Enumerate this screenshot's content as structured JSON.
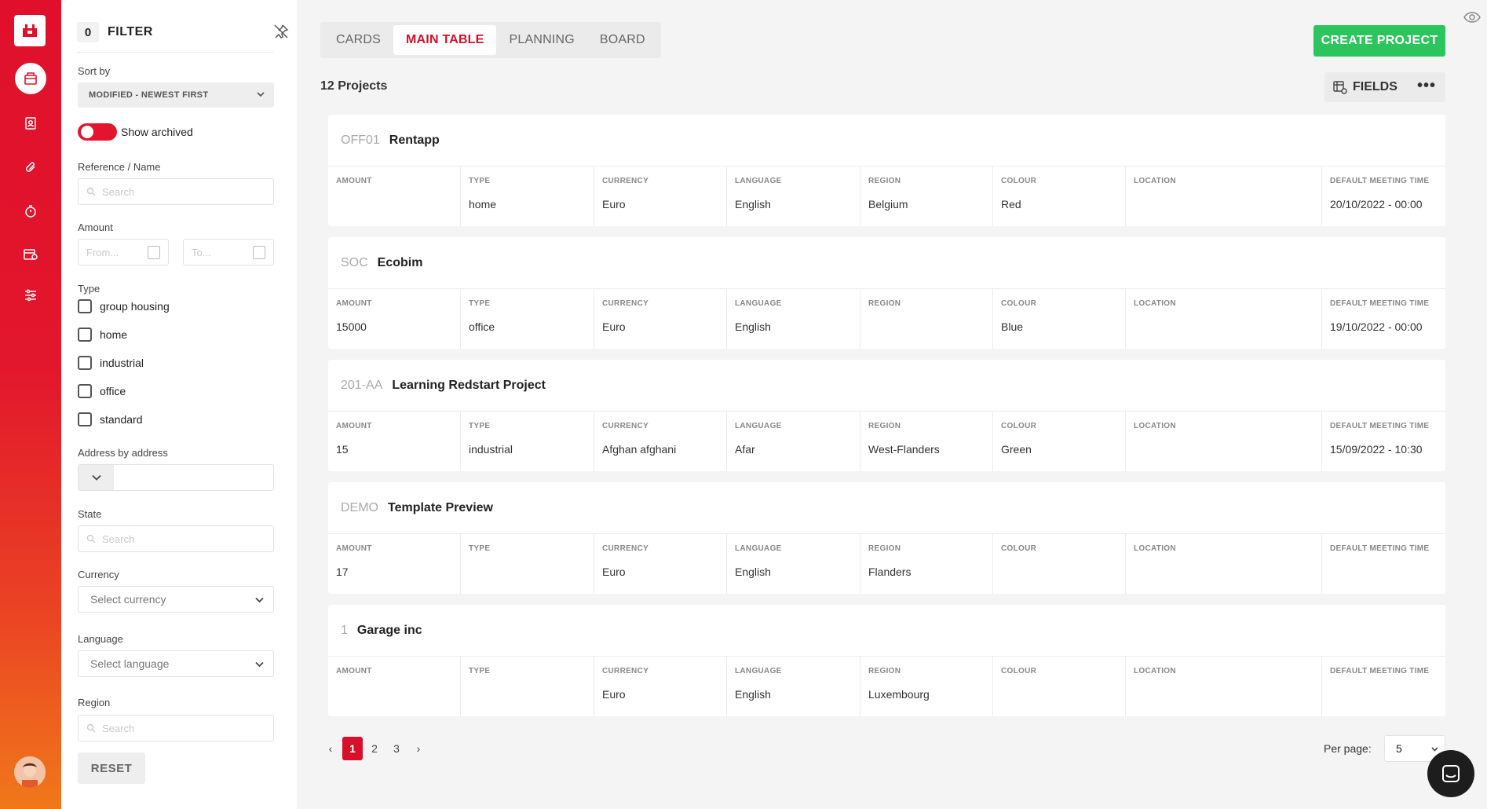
{
  "rail": {
    "items": [
      "app-logo",
      "projects-icon",
      "contacts-icon",
      "attachments-icon",
      "timer-icon",
      "invoices-icon",
      "settings-icon"
    ],
    "brand_color": "#e0102c"
  },
  "filter": {
    "count": "0",
    "title": "FILTER",
    "sort_label": "Sort by",
    "sort_value": "MODIFIED - NEWEST FIRST",
    "show_archived": "Show archived",
    "ref_label": "Reference / Name",
    "ref_placeholder": "Search",
    "amount_label": "Amount",
    "amount_from": "From...",
    "amount_to": "To...",
    "type_label": "Type",
    "types": [
      "group housing",
      "home",
      "industrial",
      "office",
      "standard"
    ],
    "address_label": "Address by address",
    "state_label": "State",
    "state_placeholder": "Search",
    "currency_label": "Currency",
    "currency_placeholder": "Select currency",
    "language_label": "Language",
    "language_placeholder": "Select language",
    "region_label": "Region",
    "region_placeholder": "Search",
    "reset": "RESET"
  },
  "main": {
    "tabs": [
      {
        "label": "CARDS",
        "active": false
      },
      {
        "label": "MAIN TABLE",
        "active": true
      },
      {
        "label": "PLANNING",
        "active": false
      },
      {
        "label": "BOARD",
        "active": false
      }
    ],
    "create_label": "CREATE PROJECT",
    "count_label": "12 Projects",
    "fields_label": "FIELDS",
    "more_label": "•••",
    "columns": [
      "AMOUNT",
      "TYPE",
      "CURRENCY",
      "LANGUAGE",
      "REGION",
      "COLOUR",
      "LOCATION",
      "DEFAULT MEETING TIME"
    ],
    "projects": [
      {
        "ref": "OFF01",
        "name": "Rentapp",
        "values": [
          "",
          "home",
          "Euro",
          "English",
          "Belgium",
          "Red",
          "",
          "20/10/2022 - 00:00"
        ]
      },
      {
        "ref": "SOC",
        "name": "Ecobim",
        "values": [
          "15000",
          "office",
          "Euro",
          "English",
          "",
          "Blue",
          "",
          "19/10/2022 - 00:00"
        ]
      },
      {
        "ref": "201-AA",
        "name": "Learning Redstart Project",
        "values": [
          "15",
          "industrial",
          "Afghan afghani",
          "Afar",
          "West-Flanders",
          "Green",
          "",
          "15/09/2022 - 10:30"
        ]
      },
      {
        "ref": "DEMO",
        "name": "Template Preview",
        "values": [
          "17",
          "",
          "Euro",
          "English",
          "Flanders",
          "",
          "",
          ""
        ]
      },
      {
        "ref": "1",
        "name": "Garage inc",
        "values": [
          "",
          "",
          "Euro",
          "English",
          "Luxembourg",
          "",
          "",
          ""
        ]
      }
    ],
    "pager": {
      "prev": "‹",
      "pages": [
        "1",
        "2",
        "3"
      ],
      "current": "1",
      "next": "›"
    },
    "per_page_label": "Per page:",
    "per_page_value": "5"
  },
  "colors": {
    "accent": "#d6102b",
    "create": "#2cc45c"
  }
}
